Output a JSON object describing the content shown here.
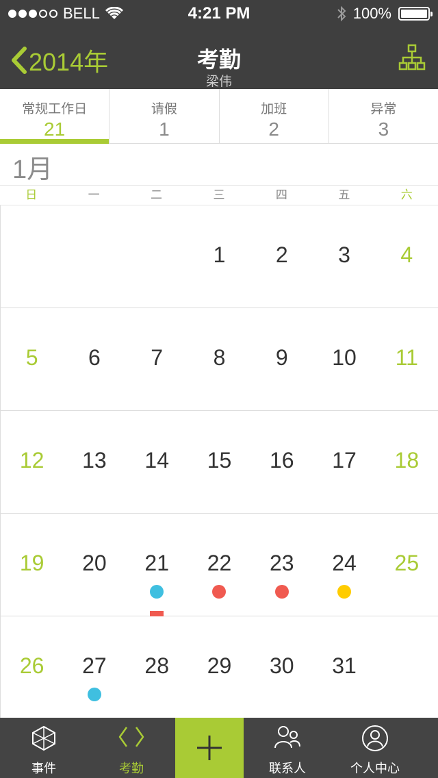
{
  "status": {
    "carrier": "BELL",
    "time": "4:21 PM",
    "battery": "100%",
    "signal_bars_filled": 3
  },
  "nav": {
    "back_label": "2014年",
    "title": "考勤",
    "subtitle": "梁伟"
  },
  "tabs": [
    {
      "label": "常规工作日",
      "count": "21",
      "active": true
    },
    {
      "label": "请假",
      "count": "1"
    },
    {
      "label": "加班",
      "count": "2"
    },
    {
      "label": "异常",
      "count": "3"
    }
  ],
  "month": "1月",
  "weekdays": [
    "日",
    "一",
    "二",
    "三",
    "四",
    "五",
    "六"
  ],
  "calendar": {
    "weeks": [
      [
        "",
        "",
        "",
        "1",
        "2",
        "3",
        "4"
      ],
      [
        "5",
        "6",
        "7",
        "8",
        "9",
        "10",
        "11"
      ],
      [
        "12",
        "13",
        "14",
        "15",
        "16",
        "17",
        "18"
      ],
      [
        "19",
        "20",
        "21",
        "22",
        "23",
        "24",
        "25"
      ],
      [
        "26",
        "27",
        "28",
        "29",
        "30",
        "31",
        ""
      ]
    ],
    "markers": {
      "21": {
        "color": "#3fbfe0",
        "bar": "#f05a50"
      },
      "22": {
        "color": "#f05a50"
      },
      "23": {
        "color": "#f05a50"
      },
      "24": {
        "color": "#ffcc00"
      },
      "27": {
        "color": "#3fbfe0"
      }
    }
  },
  "tabbar": {
    "events": "事件",
    "attendance": "考勤",
    "contacts": "联系人",
    "profile": "个人中心"
  },
  "colors": {
    "accent": "#a9cb35",
    "bar_bg": "#3f3f3f"
  }
}
